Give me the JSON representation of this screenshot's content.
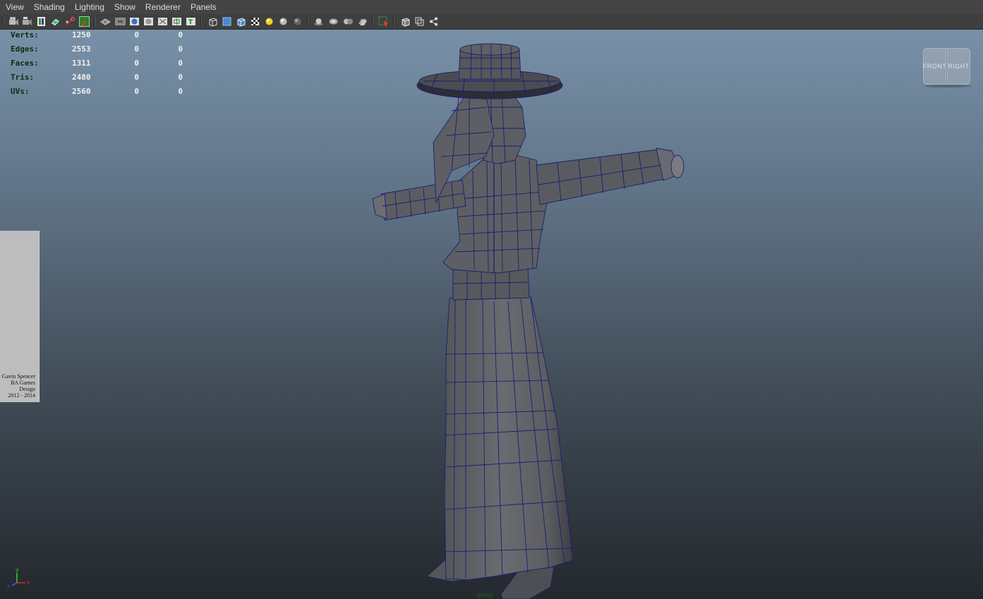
{
  "menu": [
    "View",
    "Shading",
    "Lighting",
    "Show",
    "Renderer",
    "Panels"
  ],
  "toolbar": {
    "icons": [
      "camera-icon",
      "camera-attributes-icon",
      "bookmark-icon",
      "image-plane-icon",
      "2d-pan-zoom-icon",
      "grease-pencil-icon",
      "grid-icon",
      "film-gate-icon",
      "resolution-gate-icon",
      "gate-mask-icon",
      "field-chart-icon",
      "safe-action-icon",
      "safe-title-icon",
      "wireframe-icon",
      "smooth-shade-icon",
      "wireframe-on-shaded-icon",
      "textured-icon",
      "default-light-icon",
      "shadows-icon",
      "ambient-occlusion-icon",
      "motion-blur-icon",
      "anti-alias-icon",
      "depth-of-field-icon",
      "hud-icon",
      "isolate-select-icon",
      "xray-icon",
      "xray-joints-icon",
      "xray-active-icon"
    ]
  },
  "hud": {
    "rows": [
      {
        "label": "Verts:",
        "v1": "1250",
        "v2": "0",
        "v3": "0"
      },
      {
        "label": "Edges:",
        "v1": "2553",
        "v2": "0",
        "v3": "0"
      },
      {
        "label": "Faces:",
        "v1": "1311",
        "v2": "0",
        "v3": "0"
      },
      {
        "label": "Tris:",
        "v1": "2480",
        "v2": "0",
        "v3": "0"
      },
      {
        "label": "UVs:",
        "v1": "2560",
        "v2": "0",
        "v3": "0"
      }
    ]
  },
  "viewcube": {
    "front": "FRONT",
    "right": "RIGHT"
  },
  "reference_card": {
    "lines": [
      "Gavin Spencer",
      "BA Games Design",
      "2012 - 2014"
    ]
  },
  "axis": {
    "x": "x",
    "y": "y",
    "z": "z"
  },
  "camera_label": "persp",
  "colors": {
    "wire": "#1a1f6e",
    "mesh": "#5d5e62",
    "mesh_dark": "#2c2d35",
    "hud_label": "#0f2a12"
  }
}
